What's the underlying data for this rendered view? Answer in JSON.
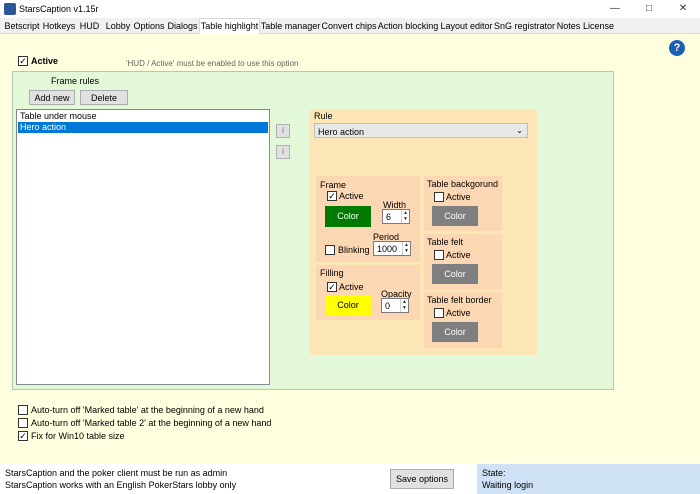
{
  "window": {
    "title": "StarsCaption v1.15r",
    "controls": [
      "—",
      "□",
      "✕"
    ]
  },
  "tabs": [
    {
      "label": "Betscript"
    },
    {
      "label": "Hotkeys"
    },
    {
      "label": "HUD"
    },
    {
      "label": "Lobby"
    },
    {
      "label": "Options"
    },
    {
      "label": "Dialogs"
    },
    {
      "label": "Table highlight"
    },
    {
      "label": "Table manager"
    },
    {
      "label": "Convert chips"
    },
    {
      "label": "Action blocking"
    },
    {
      "label": "Layout editor"
    },
    {
      "label": "SnG registrator"
    },
    {
      "label": "Notes"
    },
    {
      "label": "License"
    }
  ],
  "active_tab": "Table highlight",
  "main": {
    "active_label": "Active",
    "active_checked": true,
    "hint": "'HUD / Active' must be enabled to use this option",
    "frame_rules_label": "Frame rules",
    "add_new_label": "Add new",
    "delete_label": "Delete",
    "rules_list": [
      {
        "label": "Table under mouse",
        "selected": false
      },
      {
        "label": "Hero action",
        "selected": true
      }
    ],
    "up_button": "i",
    "down_button": "i",
    "rule": {
      "title": "Rule",
      "selected": "Hero action",
      "frame": {
        "title": "Frame",
        "active_label": "Active",
        "active_checked": true,
        "color_label": "Color",
        "color": "#007a00",
        "width_label": "Width",
        "width_value": "6",
        "blinking_label": "Blinking",
        "blinking_checked": false,
        "period_label": "Period",
        "period_value": "1000"
      },
      "filling": {
        "title": "Filling",
        "active_label": "Active",
        "active_checked": true,
        "color_label": "Color",
        "color": "#ffff00",
        "opacity_label": "Opacity",
        "opacity_value": "0"
      },
      "background": {
        "title": "Table backgorund",
        "active_label": "Active",
        "active_checked": false,
        "color_label": "Color",
        "color": "#7f7f7f"
      },
      "felt": {
        "title": "Table felt",
        "active_label": "Active",
        "active_checked": false,
        "color_label": "Color",
        "color": "#7f7f7f"
      },
      "felt_border": {
        "title": "Table felt border",
        "active_label": "Active",
        "active_checked": false,
        "color_label": "Color",
        "color": "#7f7f7f"
      }
    }
  },
  "options": [
    {
      "label": "Auto-turn off 'Marked table' at the beginning of a new hand",
      "checked": false
    },
    {
      "label": "Auto-turn off 'Marked table 2' at the beginning of a new hand",
      "checked": false
    },
    {
      "label": "Fix for Win10 table size",
      "checked": true
    }
  ],
  "status": {
    "line1": "StarsCaption and the poker client must be run as admin",
    "line2": "StarsCaption works with an English PokerStars lobby only",
    "save_label": "Save options",
    "state_label": "State:",
    "state_value": "Waiting login"
  },
  "help_glyph": "?"
}
